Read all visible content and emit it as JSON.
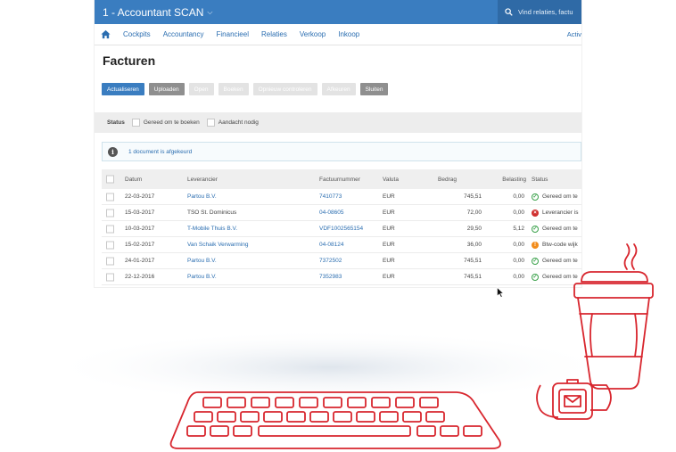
{
  "app": {
    "title": "1 - Accountant SCAN",
    "search_placeholder": "Vind relaties, factu"
  },
  "nav": {
    "items": [
      "Cockpits",
      "Accountancy",
      "Financieel",
      "Relaties",
      "Verkoop",
      "Inkoop"
    ],
    "right": "Activ"
  },
  "page": {
    "title": "Facturen"
  },
  "toolbar": {
    "buttons": [
      {
        "label": "Actualiseren",
        "style": "primary"
      },
      {
        "label": "Uploaden",
        "style": "dark"
      },
      {
        "label": "Open",
        "style": "disabled"
      },
      {
        "label": "Boeken",
        "style": "disabled"
      },
      {
        "label": "Opnieuw controleren",
        "style": "disabled"
      },
      {
        "label": "Afkeuren",
        "style": "disabled"
      },
      {
        "label": "Sluiten",
        "style": "dark"
      }
    ]
  },
  "filter": {
    "label": "Status",
    "options": [
      "Gereed om te boeken",
      "Aandacht nodig"
    ]
  },
  "info": {
    "message": "1 document is afgekeurd"
  },
  "table": {
    "headers": {
      "datum": "Datum",
      "leverancier": "Leverancier",
      "factuurnummer": "Factuurnummer",
      "valuta": "Valuta",
      "bedrag": "Bedrag",
      "belasting": "Belasting",
      "status": "Status"
    },
    "rows": [
      {
        "datum": "22-03-2017",
        "leverancier": "Partou B.V.",
        "lev_link": true,
        "factuurnummer": "7410773",
        "valuta": "EUR",
        "bedrag": "745,51",
        "belasting": "0,00",
        "status_icon": "ok",
        "status": "Gereed om te"
      },
      {
        "datum": "15-03-2017",
        "leverancier": "TSO St. Dominicus",
        "lev_link": false,
        "factuurnummer": "04-08605",
        "valuta": "EUR",
        "bedrag": "72,00",
        "belasting": "0,00",
        "status_icon": "err",
        "status": "Leverancier is"
      },
      {
        "datum": "10-03-2017",
        "leverancier": "T-Mobile Thuis B.V.",
        "lev_link": true,
        "factuurnummer": "VDF1002565154",
        "valuta": "EUR",
        "bedrag": "29,50",
        "belasting": "5,12",
        "status_icon": "ok",
        "status": "Gereed om te"
      },
      {
        "datum": "15-02-2017",
        "leverancier": "Van Schaik Verwarming",
        "lev_link": true,
        "factuurnummer": "04-08124",
        "valuta": "EUR",
        "bedrag": "36,00",
        "belasting": "0,00",
        "status_icon": "warn",
        "status": "Btw-code wijk"
      },
      {
        "datum": "24-01-2017",
        "leverancier": "Partou B.V.",
        "lev_link": true,
        "factuurnummer": "7372502",
        "valuta": "EUR",
        "bedrag": "745,51",
        "belasting": "0,00",
        "status_icon": "ok",
        "status": "Gereed om te"
      },
      {
        "datum": "22-12-2016",
        "leverancier": "Partou B.V.",
        "lev_link": true,
        "factuurnummer": "7352983",
        "valuta": "EUR",
        "bedrag": "745,51",
        "belasting": "0,00",
        "status_icon": "ok",
        "status": "Gereed om te"
      }
    ]
  },
  "colors": {
    "brand_blue": "#3a7dc0",
    "link_blue": "#2a6db0",
    "illustration_red": "#d8262e",
    "ok_green": "#3aa14a",
    "error_red": "#d0302f",
    "warn_orange": "#f28c1b"
  }
}
